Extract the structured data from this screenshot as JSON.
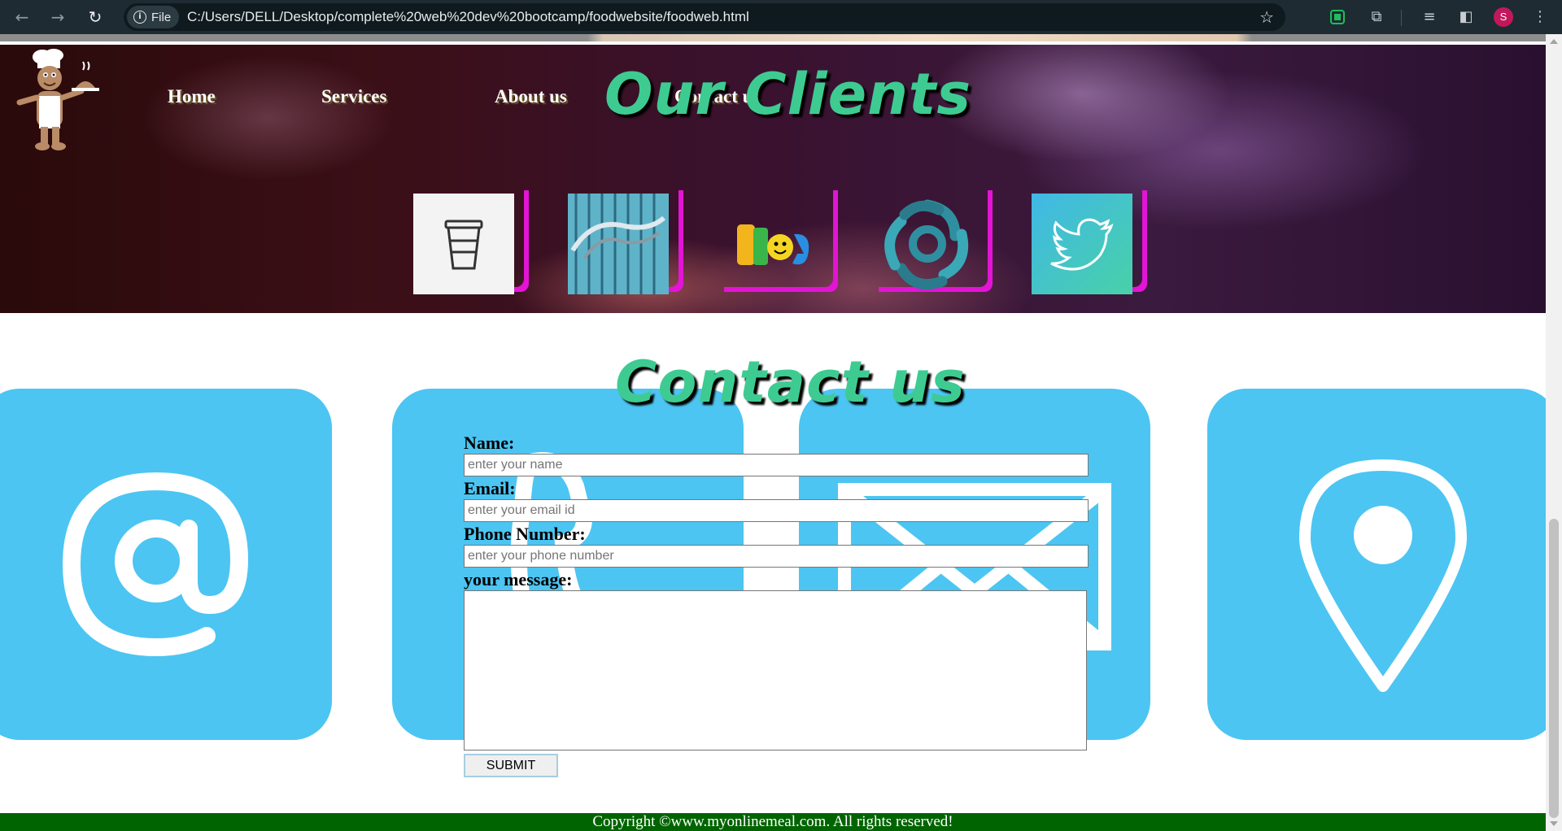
{
  "browser": {
    "file_chip": "File",
    "url": "C:/Users/DELL/Desktop/complete%20web%20dev%20bootcamp/foodwebsite/foodweb.html",
    "profile_initial": "S"
  },
  "nav": {
    "home": "Home",
    "services": "Services",
    "about": "About us",
    "contact": "Contact us"
  },
  "clients": {
    "title": "Our Clients",
    "logos": [
      "coffee-cup-icon",
      "building-sign-logo",
      "blog-logo",
      "knot-logo",
      "twitter-icon"
    ]
  },
  "contact": {
    "title": "Contact us",
    "tiles": [
      "at-sign-icon",
      "phone-icon",
      "mail-icon",
      "location-pin-icon"
    ],
    "name_label": "Name:",
    "name_placeholder": "enter your name",
    "email_label": "Email:",
    "email_placeholder": "enter your email id",
    "phone_label": "Phone Number:",
    "phone_placeholder": "enter your phone number",
    "message_label": "your message:",
    "submit_label": "SUBMIT"
  },
  "footer": {
    "text": "Copyright ©www.myonlinemeal.com. All rights reserved!"
  },
  "colors": {
    "accent_green": "#3ecb92",
    "tile_blue": "#4cc5f2",
    "card_shadow_magenta": "#e314d6",
    "footer_green": "#006400"
  }
}
